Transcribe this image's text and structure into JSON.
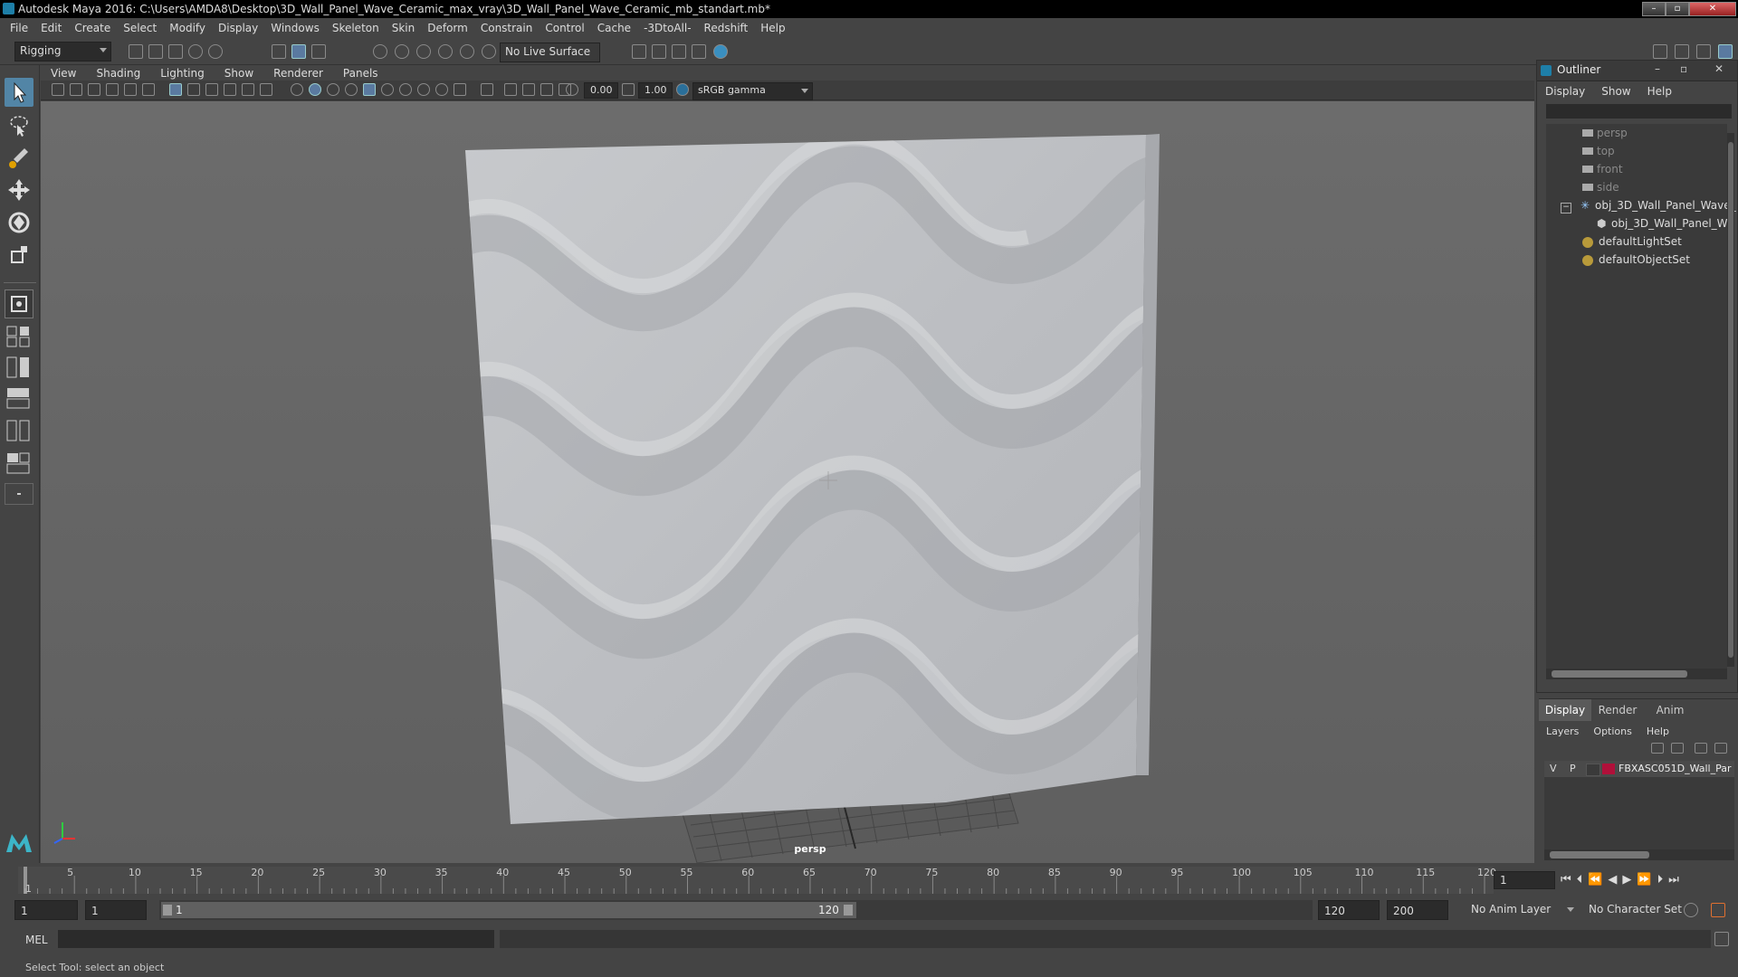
{
  "window": {
    "title": "Autodesk Maya 2016: C:\\Users\\AMDA8\\Desktop\\3D_Wall_Panel_Wave_Ceramic_max_vray\\3D_Wall_Panel_Wave_Ceramic_mb_standart.mb*"
  },
  "menubar": [
    "File",
    "Edit",
    "Create",
    "Select",
    "Modify",
    "Display",
    "Windows",
    "Skeleton",
    "Skin",
    "Deform",
    "Constrain",
    "Control",
    "Cache",
    "-3DtoAll-",
    "Redshift",
    "Help"
  ],
  "toolbar": {
    "menuset": "Rigging",
    "live_surface": "No Live Surface"
  },
  "viewport": {
    "menus": [
      "View",
      "Shading",
      "Lighting",
      "Show",
      "Renderer",
      "Panels"
    ],
    "exposure": "0.00",
    "gamma": "1.00",
    "color_space": "sRGB gamma",
    "camera_label": "persp"
  },
  "outliner": {
    "title": "Outliner",
    "menus": [
      "Display",
      "Show",
      "Help"
    ],
    "items": [
      {
        "label": "persp",
        "icon": "camera-icon"
      },
      {
        "label": "top",
        "icon": "camera-icon"
      },
      {
        "label": "front",
        "icon": "camera-icon"
      },
      {
        "label": "side",
        "icon": "camera-icon"
      },
      {
        "label": "obj_3D_Wall_Panel_Wave_",
        "icon": "group-icon"
      },
      {
        "label": "obj_3D_Wall_Panel_W",
        "icon": "mesh-icon"
      },
      {
        "label": "defaultLightSet",
        "icon": "set-icon"
      },
      {
        "label": "defaultObjectSet",
        "icon": "set-icon"
      }
    ]
  },
  "layers": {
    "tabs": [
      "Display",
      "Render",
      "Anim"
    ],
    "menus": [
      "Layers",
      "Options",
      "Help"
    ],
    "layer": {
      "v": "V",
      "p": "P",
      "name": "FBXASC051D_Wall_Par",
      "color": "#b0103a"
    }
  },
  "timeline": {
    "ticks": [
      "1",
      "5",
      "10",
      "15",
      "20",
      "25",
      "30",
      "35",
      "40",
      "45",
      "50",
      "55",
      "60",
      "65",
      "70",
      "75",
      "80",
      "85",
      "90",
      "95",
      "100",
      "105",
      "110",
      "115",
      "120"
    ],
    "current_frame": "1"
  },
  "range": {
    "start": "1",
    "playback_start": "1",
    "slider_start": "1",
    "slider_end": "120",
    "playback_end": "120",
    "end": "200",
    "anim_layer": "No Anim Layer",
    "character_set": "No Character Set"
  },
  "cmdline": {
    "label": "MEL"
  },
  "helpline": {
    "text": "Select Tool: select an object"
  },
  "colors": {
    "accent": "#5285a6",
    "layer_color": "#b0103a"
  }
}
